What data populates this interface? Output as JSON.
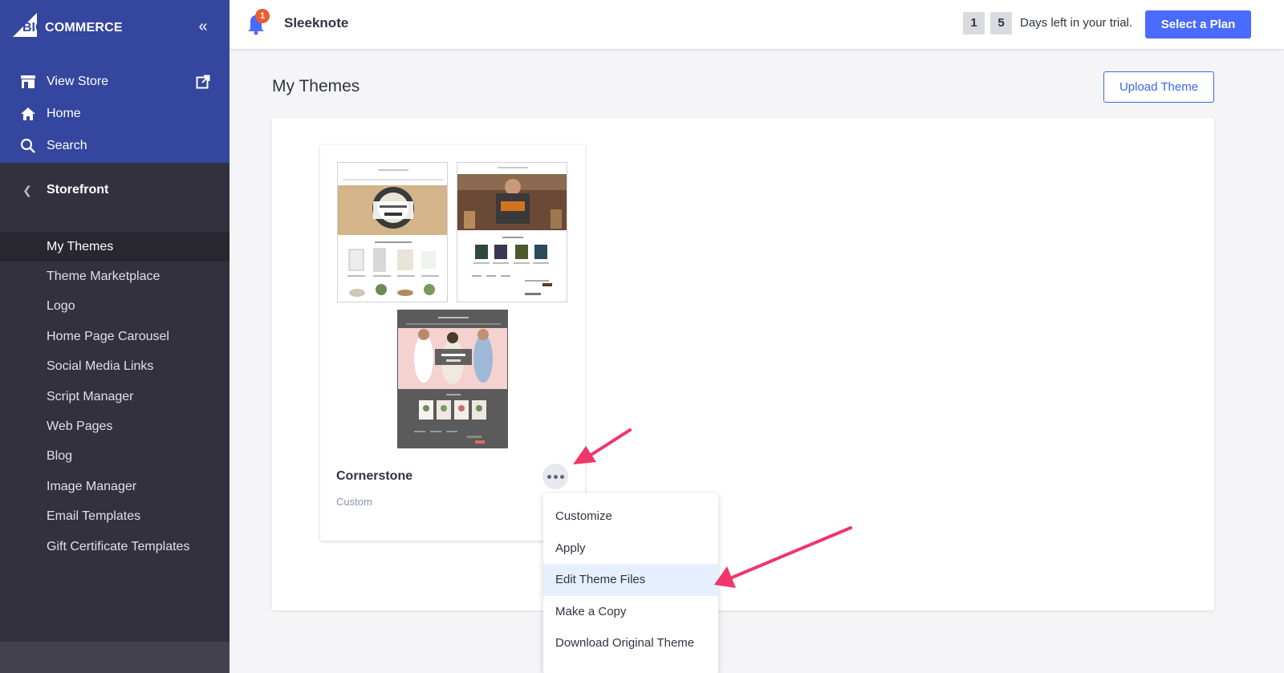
{
  "brand": {
    "logo_text": "COMMERCE",
    "logo_mark": "BIG"
  },
  "sidebar": {
    "top_items": [
      {
        "label": "View Store",
        "icon": "storefront-icon"
      },
      {
        "label": "Home",
        "icon": "home-icon"
      },
      {
        "label": "Search",
        "icon": "search-icon"
      }
    ],
    "section": "Storefront",
    "items": [
      {
        "label": "My Themes",
        "active": true
      },
      {
        "label": "Theme Marketplace"
      },
      {
        "label": "Logo"
      },
      {
        "label": "Home Page Carousel"
      },
      {
        "label": "Social Media Links"
      },
      {
        "label": "Script Manager"
      },
      {
        "label": "Web Pages"
      },
      {
        "label": "Blog"
      },
      {
        "label": "Image Manager"
      },
      {
        "label": "Email Templates"
      },
      {
        "label": "Gift Certificate Templates"
      }
    ]
  },
  "header": {
    "notification_count": "1",
    "store_name": "Sleeknote",
    "trial_days": [
      "1",
      "5"
    ],
    "trial_text": "Days left in your trial.",
    "select_plan": "Select a Plan"
  },
  "main": {
    "title": "My Themes",
    "upload_button": "Upload Theme",
    "theme": {
      "name": "Cornerstone",
      "type": "Custom"
    },
    "menu": [
      "Customize",
      "Apply",
      "Edit Theme Files",
      "Make a Copy",
      "Download Original Theme"
    ],
    "highlighted_menu_item": "Edit Theme Files"
  },
  "colors": {
    "sidebar_top": "#34469e",
    "sidebar": "#34313f",
    "primary": "#4a6bff",
    "annotation_arrow": "#f0356b",
    "badge": "#ee5a32"
  }
}
